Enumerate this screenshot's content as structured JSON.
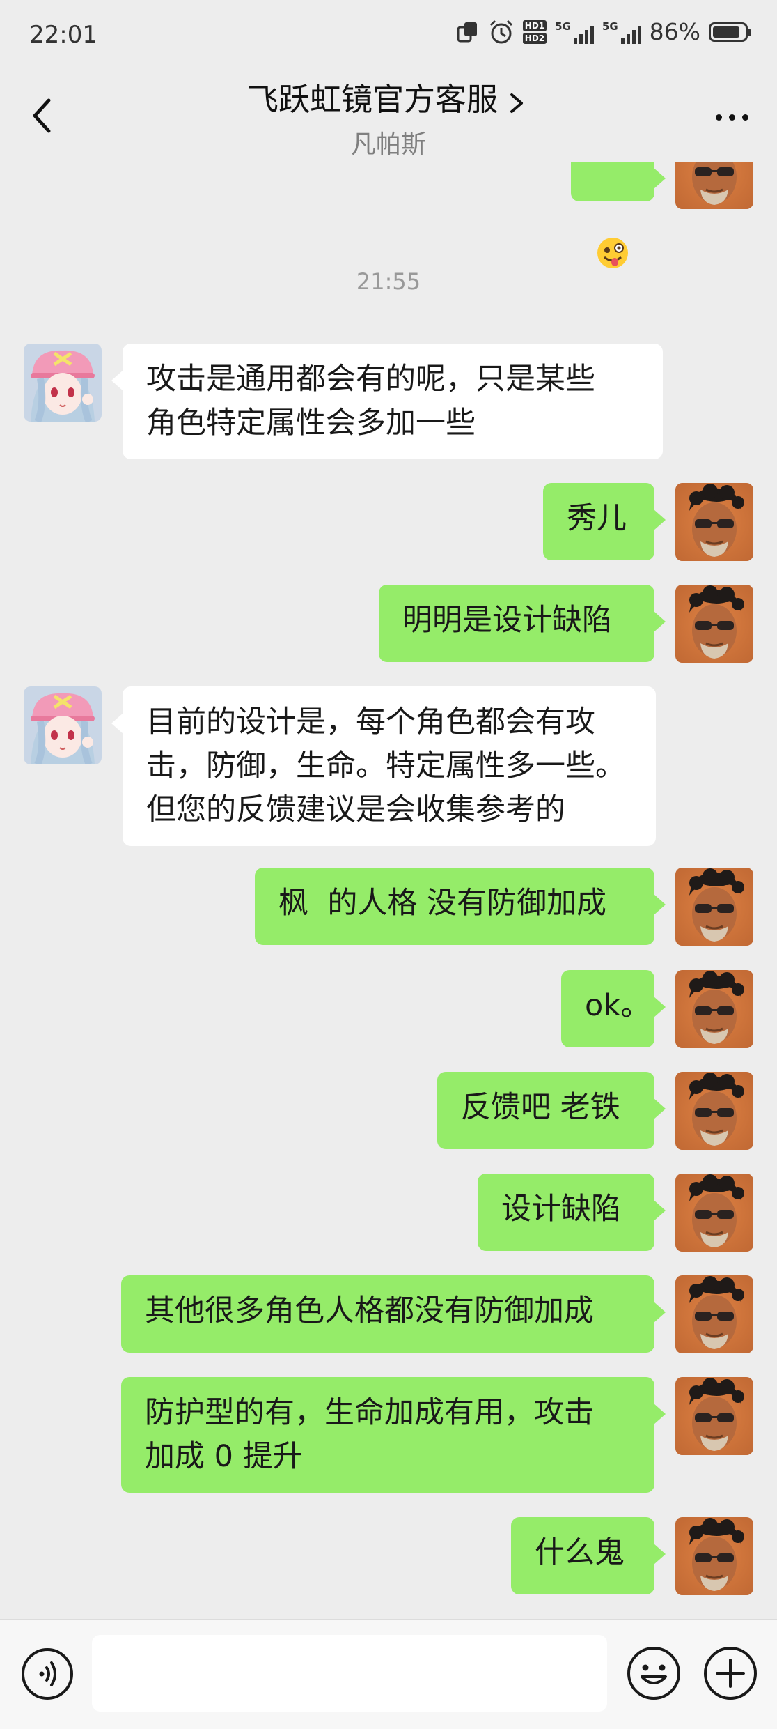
{
  "status_bar": {
    "time": "22:01",
    "network_label_1": "5G",
    "network_label_2": "5G",
    "hd_label_1": "HD1",
    "hd_label_2": "HD2",
    "battery": "86%",
    "battery_level": 0.86
  },
  "nav": {
    "title": "飞跃虹镜官方客服",
    "subtitle": "凡帕斯"
  },
  "chat": {
    "timestamp": "21:55",
    "messages": [
      {
        "sender": "agent",
        "text": "攻击是通用都会有的呢，只是某些\n角色特定属性会多加一些"
      },
      {
        "sender": "me",
        "text": "秀儿"
      },
      {
        "sender": "me",
        "text": "明明是设计缺陷"
      },
      {
        "sender": "agent",
        "text": "目前的设计是，每个角色都会有攻\n击，防御，生命。特定属性多一些。\n但您的反馈建议是会收集参考的"
      },
      {
        "sender": "me",
        "text": "枫  的人格 没有防御加成"
      },
      {
        "sender": "me",
        "text": "ok。"
      },
      {
        "sender": "me",
        "text": "反馈吧 老铁"
      },
      {
        "sender": "me",
        "text": "设计缺陷"
      },
      {
        "sender": "me",
        "text": "其他很多角色人格都没有防御加成"
      },
      {
        "sender": "me",
        "text": "防护型的有，生命加成有用，攻击\n加成 0 提升"
      },
      {
        "sender": "me",
        "text": "什么鬼"
      }
    ]
  },
  "input_bar": {
    "placeholder": ""
  },
  "colors": {
    "background": "#ededed",
    "my_bubble": "#95ec69",
    "agent_bubble": "#ffffff"
  },
  "icons": [
    "back-icon",
    "chevron-right-icon",
    "more-icon",
    "voice-icon",
    "emoji-icon",
    "plus-icon",
    "alarm-icon",
    "screen-icon",
    "signal-icon",
    "battery-icon"
  ]
}
